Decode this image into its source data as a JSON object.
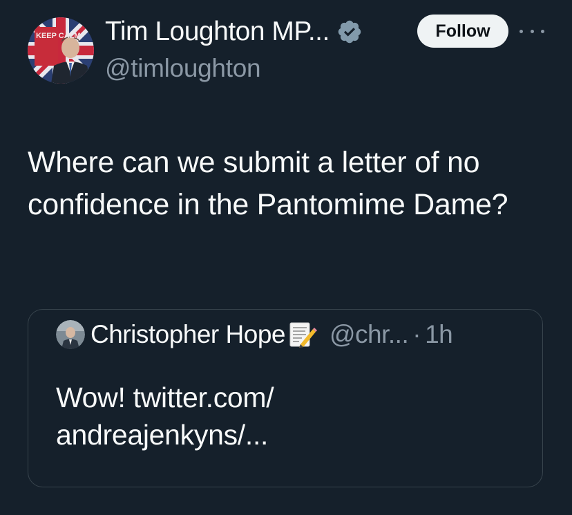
{
  "author": {
    "display_name": "Tim Loughton MP...",
    "handle": "@timloughton",
    "avatar_caption": "KEEP CALM",
    "verified": true
  },
  "actions": {
    "follow_label": "Follow"
  },
  "tweet": {
    "text": "Where can we submit a letter of no confidence in the Pantomime Dame?"
  },
  "quoted_tweet": {
    "author_name": "Christopher Hope",
    "author_emoji": "memo-icon",
    "author_handle": "@chr...",
    "separator": "·",
    "time": "1h",
    "text_line_1": "Wow! twitter.com/",
    "text_line_2": "andreajenkyns/..."
  },
  "colors": {
    "background": "#15202b",
    "text_primary": "#f7f9f9",
    "text_secondary": "#8b98a5",
    "border": "#38444d",
    "verified": "#829aab",
    "follow_bg": "#eff3f4"
  }
}
